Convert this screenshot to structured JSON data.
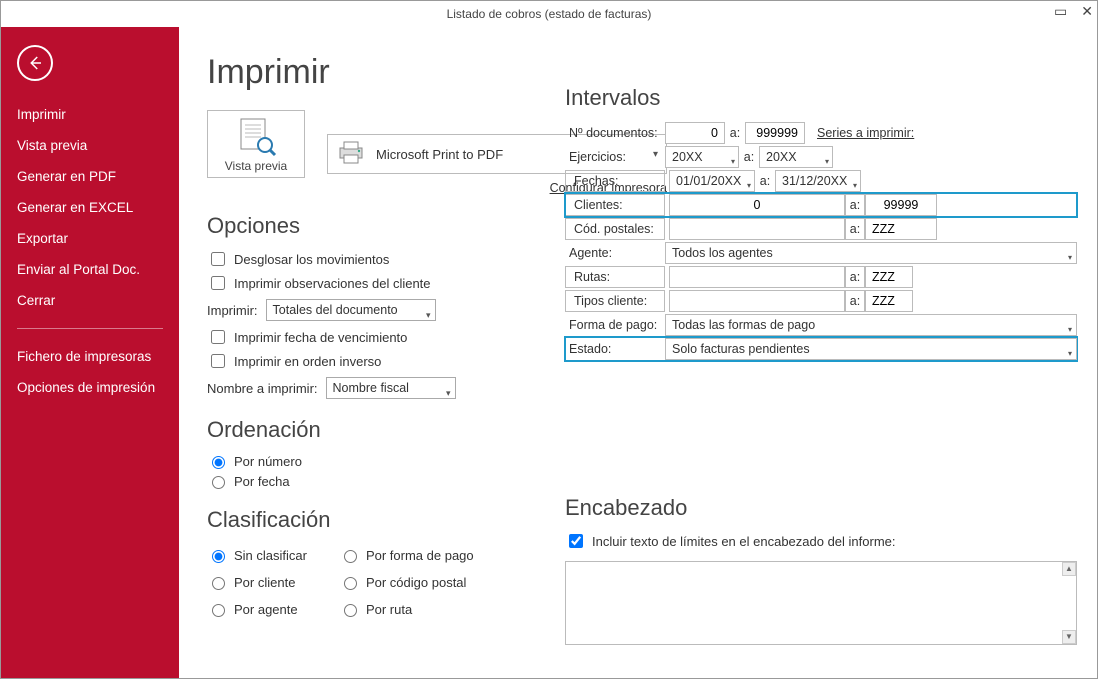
{
  "window": {
    "title": "Listado de cobros (estado de facturas)"
  },
  "sidebar": {
    "items": [
      "Imprimir",
      "Vista previa",
      "Generar en PDF",
      "Generar en EXCEL",
      "Exportar",
      "Enviar al Portal Doc.",
      "Cerrar"
    ],
    "bottom": [
      "Fichero de impresoras",
      "Opciones de impresión"
    ]
  },
  "page": {
    "title": "Imprimir",
    "preview_label": "Vista previa",
    "printer_name": "Microsoft Print to PDF",
    "configure_link": "Configurar impresora"
  },
  "opciones": {
    "heading": "Opciones",
    "desglosar": "Desglosar los movimientos",
    "obs": "Imprimir observaciones del cliente",
    "imprimir_label": "Imprimir:",
    "imprimir_sel": "Totales del documento",
    "fvenc": "Imprimir fecha de vencimiento",
    "inverso": "Imprimir en orden inverso",
    "nombre_label": "Nombre a imprimir:",
    "nombre_sel": "Nombre fiscal"
  },
  "ordenacion": {
    "heading": "Ordenación",
    "por_numero": "Por número",
    "por_fecha": "Por fecha"
  },
  "clasificacion": {
    "heading": "Clasificación",
    "sin": "Sin clasificar",
    "cliente": "Por cliente",
    "agente": "Por agente",
    "forma": "Por forma de pago",
    "cp": "Por código postal",
    "ruta": "Por ruta"
  },
  "intervalos": {
    "heading": "Intervalos",
    "ndoc_label": "Nº documentos:",
    "ndoc_from": "0",
    "a": "a:",
    "ndoc_to": "999999",
    "series_link": "Series a imprimir:",
    "ej_label": "Ejercicios:",
    "ej_from": "20XX",
    "ej_to": "20XX",
    "fechas_label": "Fechas:",
    "fechas_from": "01/01/20XX",
    "fechas_to": "31/12/20XX",
    "clientes_label": "Clientes:",
    "clientes_from": "0",
    "clientes_to": "99999",
    "cp_label": "Cód. postales:",
    "cp_to": "ZZZ",
    "agente_label": "Agente:",
    "agente_sel": "Todos los agentes",
    "rutas_label": "Rutas:",
    "rutas_to": "ZZZ",
    "tc_label": "Tipos cliente:",
    "tc_to": "ZZZ",
    "fp_label": "Forma de pago:",
    "fp_sel": "Todas las formas de pago",
    "estado_label": "Estado:",
    "estado_sel": "Solo facturas pendientes"
  },
  "encabezado": {
    "heading": "Encabezado",
    "incluir": "Incluir texto de límites en el encabezado del informe:"
  }
}
